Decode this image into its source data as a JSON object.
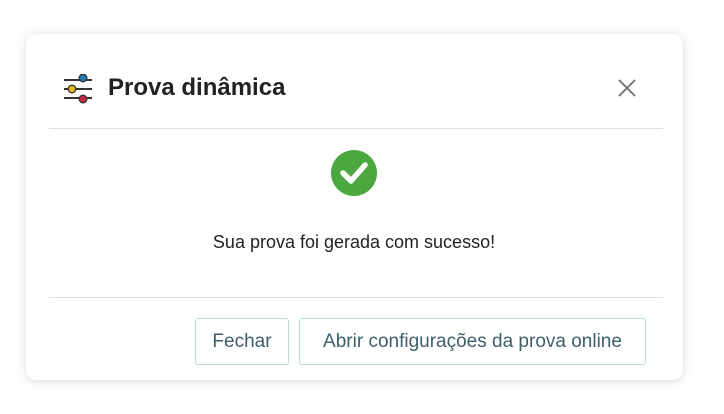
{
  "dialog": {
    "title": "Prova dinâmica",
    "header_icon": "sliders-icon",
    "close_icon": "close-icon",
    "status_icon": "check-circle-icon",
    "message": "Sua prova foi gerada com sucesso!",
    "buttons": {
      "close_label": "Fechar",
      "open_settings_label": "Abrir configurações da prova online"
    }
  },
  "colors": {
    "success": "#4aa83f",
    "button_text": "#3d5f6c",
    "button_border": "#b9dedd",
    "slider_blue": "#1f7cb5",
    "slider_yellow": "#e8b21b",
    "slider_red": "#c9264a"
  }
}
